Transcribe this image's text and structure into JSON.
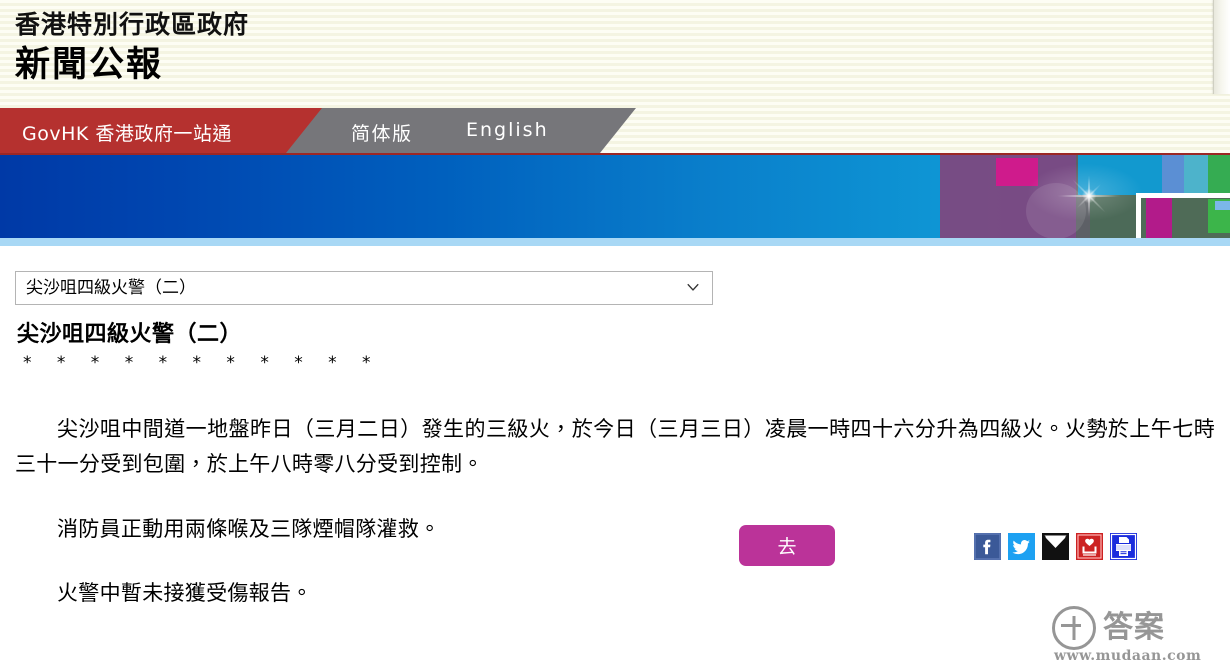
{
  "header": {
    "line1": "香港特別行政區政府",
    "line2": "新聞公報"
  },
  "nav": {
    "govhk": "GovHK 香港政府一站通",
    "simplified": "简体版",
    "english": "English",
    "red_color": "#b5312f",
    "gray_color": "#76767a"
  },
  "banner": {
    "gradient_from": "#0039a6",
    "gradient_to": "#0e95d4",
    "bottom_strip_color": "#a8d8f5"
  },
  "controls": {
    "select_value": "尖沙咀四級火警（二）",
    "select_icon": "chevron-down-icon",
    "go_label": "去",
    "go_color": "#bb3399",
    "social": [
      {
        "name": "facebook-icon",
        "label": "Facebook",
        "color": "#3b5998"
      },
      {
        "name": "twitter-icon",
        "label": "Twitter",
        "color": "#1da1f2"
      },
      {
        "name": "email-icon",
        "label": "Email",
        "color": "#000000"
      },
      {
        "name": "save-icon",
        "label": "Save",
        "color": "#cc2222"
      },
      {
        "name": "print-icon",
        "label": "Print",
        "color": "#1b2ddd"
      }
    ]
  },
  "article": {
    "headline": "尖沙咀四級火警（二）",
    "stars": "* * * * * * * * * * *",
    "paragraphs": [
      "尖沙咀中間道一地盤昨日（三月二日）發生的三級火，於今日（三月三日）凌晨一時四十六分升為四級火。火勢於上午七時三十一分受到包圍，於上午八時零八分受到控制。",
      "消防員正動用兩條喉及三隊煙帽隊灌救。",
      "火警中暫未接獲受傷報告。"
    ]
  },
  "watermark": {
    "logo_char": "答",
    "brand": "答案",
    "url": "www.mudaan.com"
  }
}
